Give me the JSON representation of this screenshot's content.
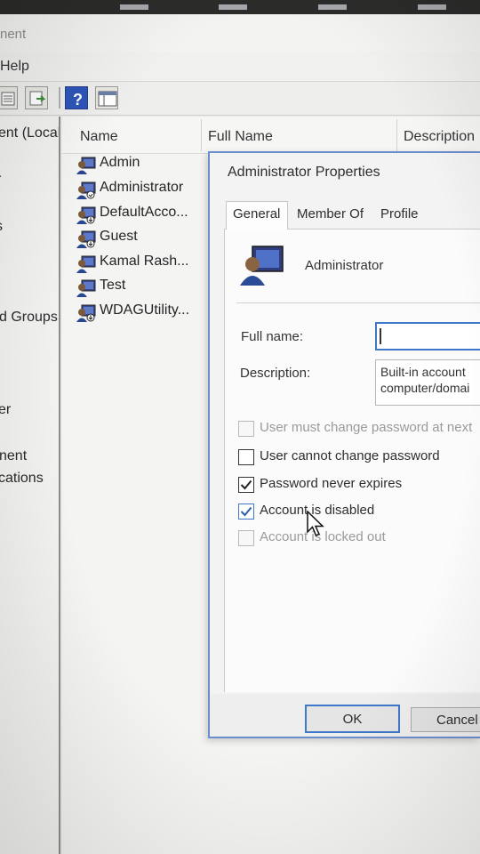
{
  "window": {
    "title_fragment": "nent",
    "menu_help": "Help"
  },
  "tree": {
    "items": [
      "ent (Local",
      "r",
      "s",
      "d Groups",
      "er",
      "nent",
      "cations"
    ]
  },
  "list": {
    "columns": [
      "Name",
      "Full Name",
      "Description"
    ],
    "users": [
      "Admin",
      "Administrator",
      "DefaultAcco...",
      "Guest",
      "Kamal Rash...",
      "Test",
      "WDAGUtility..."
    ]
  },
  "dialog": {
    "title": "Administrator Properties",
    "tabs": [
      "General",
      "Member Of",
      "Profile"
    ],
    "active_tab": "General",
    "user_name": "Administrator",
    "full_name_label": "Full name:",
    "full_name_value": "",
    "description_label": "Description:",
    "description_line1": "Built-in account",
    "description_line2": "computer/domai",
    "checkboxes": [
      {
        "label": "User must change password at next",
        "checked": false,
        "enabled": false
      },
      {
        "label": "User cannot change password",
        "checked": false,
        "enabled": true
      },
      {
        "label": "Password never expires",
        "checked": true,
        "enabled": true
      },
      {
        "label": "Account is disabled",
        "checked": true,
        "enabled": true
      },
      {
        "label": "Account is locked out",
        "checked": false,
        "enabled": false
      }
    ],
    "ok_label": "OK",
    "cancel_label": "Cancel"
  },
  "colors": {
    "accent": "#3f78c8",
    "dialog_border": "#6b8fcc"
  },
  "icons": {
    "user": "user-monitor-icon",
    "help": "help-icon",
    "checkmark": "checkmark-icon",
    "cursor": "mouse-pointer-icon"
  }
}
